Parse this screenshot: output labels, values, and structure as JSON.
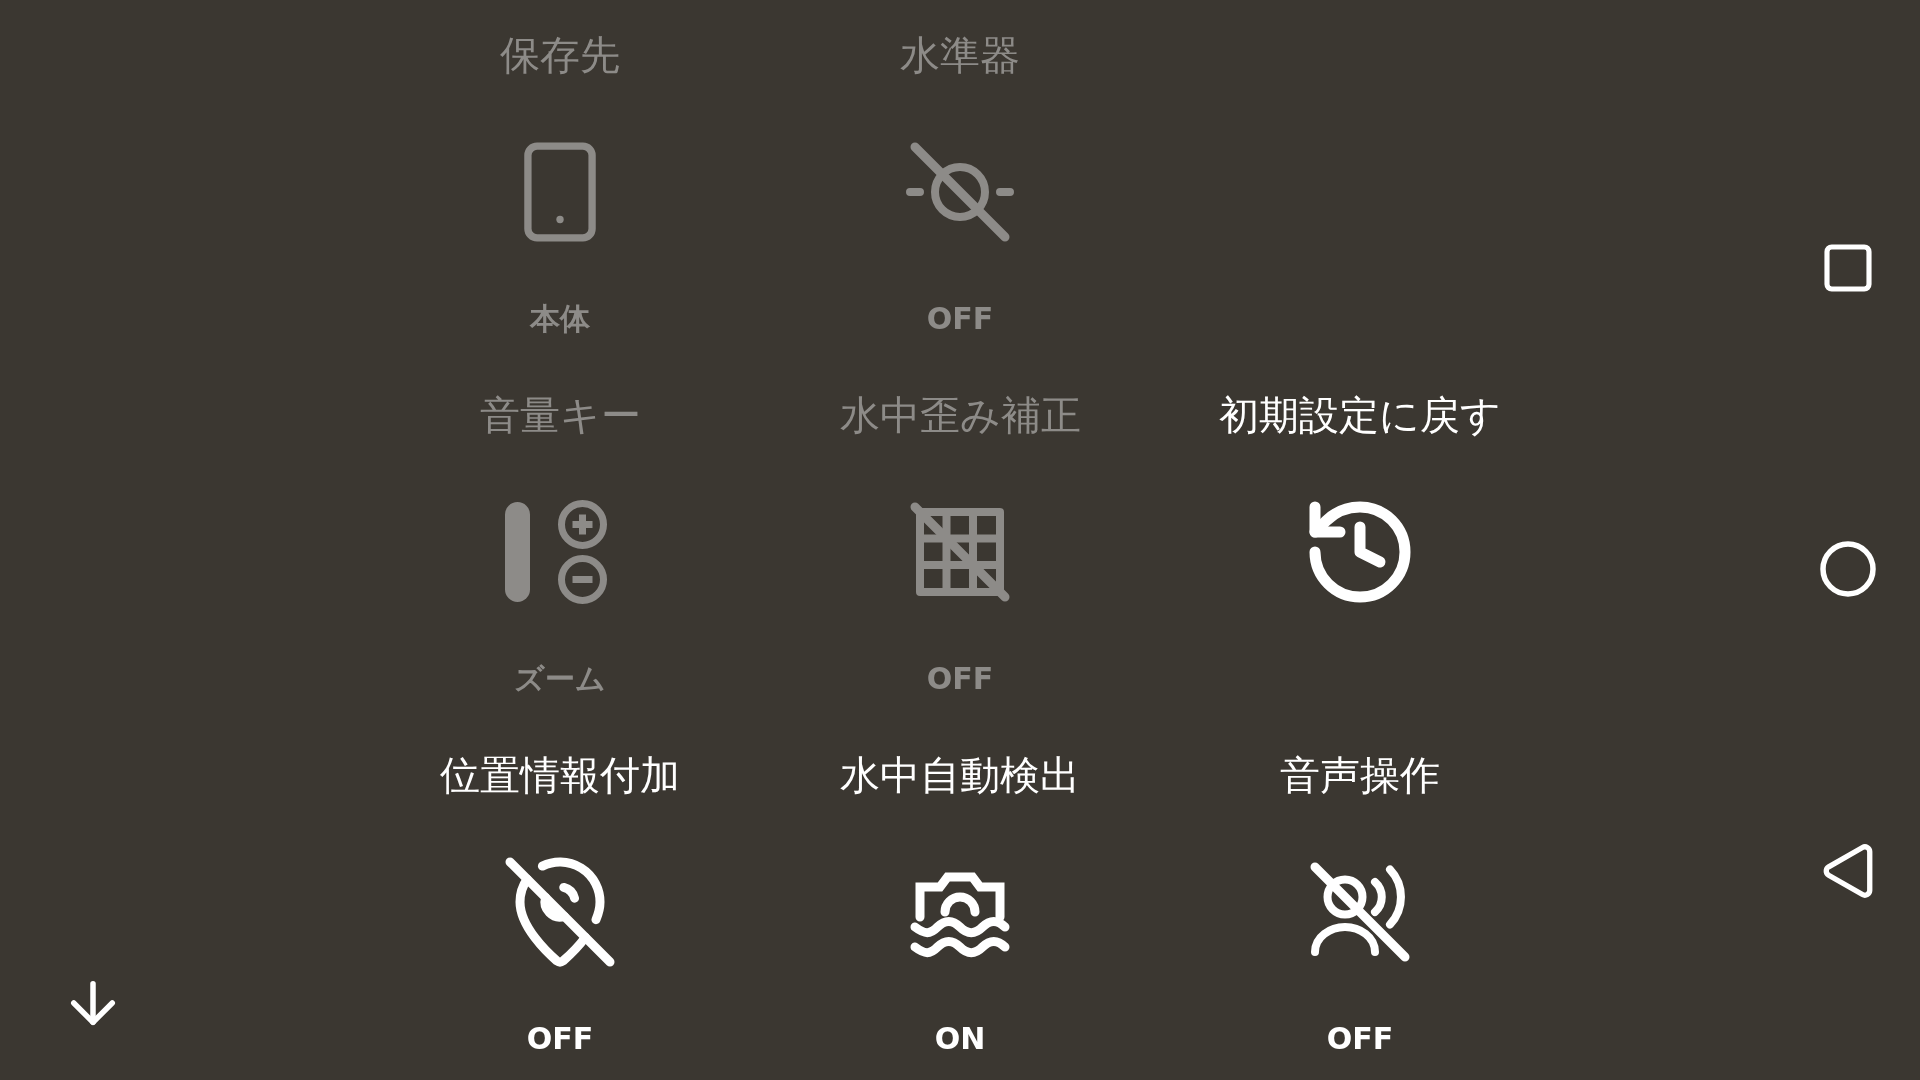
{
  "settings_rows": [
    {
      "items": [
        {
          "label": "保存先",
          "kind": "storage",
          "value": "本体",
          "disabled": true
        },
        {
          "label": "水準器",
          "kind": "level",
          "value": "OFF",
          "disabled": true
        }
      ]
    },
    {
      "items": [
        {
          "label": "音量キー",
          "kind": "volume",
          "value": "ズーム",
          "disabled": true
        },
        {
          "label": "水中歪み補正",
          "kind": "distortion",
          "value": "OFF",
          "disabled": true
        },
        {
          "label": "初期設定に戻す",
          "kind": "reset",
          "disabled": false
        }
      ]
    },
    {
      "items": [
        {
          "label": "位置情報付加",
          "kind": "location",
          "value": "OFF",
          "disabled": false
        },
        {
          "label": "水中自動検出",
          "kind": "underwater",
          "value": "ON",
          "disabled": false
        },
        {
          "label": "音声操作",
          "kind": "voice",
          "value": "OFF",
          "disabled": false
        }
      ]
    }
  ]
}
